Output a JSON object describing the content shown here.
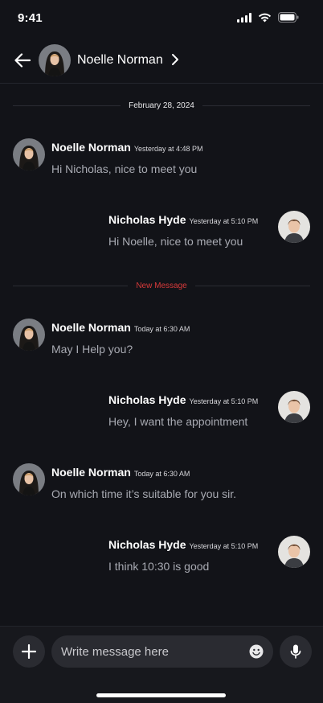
{
  "status_bar": {
    "time": "9:41"
  },
  "header": {
    "contact_name": "Noelle Norman"
  },
  "date_divider": "February 28, 2024",
  "new_divider": "New Message",
  "messages": [
    {
      "sender": "Noelle Norman",
      "time": "Yesterday at 4:48 PM",
      "text": "Hi Nicholas, nice to meet you",
      "direction": "incoming"
    },
    {
      "sender": "Nicholas Hyde",
      "time": "Yesterday at 5:10 PM",
      "text": "Hi Noelle, nice to meet you",
      "direction": "outgoing"
    },
    {
      "sender": "Noelle Norman",
      "time": "Today at 6:30 AM",
      "text": "May I Help you?",
      "direction": "incoming"
    },
    {
      "sender": "Nicholas Hyde",
      "time": "Yesterday at 5:10 PM",
      "text": "Hey, I want the appointment",
      "direction": "outgoing"
    },
    {
      "sender": "Noelle Norman",
      "time": "Today at 6:30 AM",
      "text": "On which time it’s suitable for you sir.",
      "direction": "incoming"
    },
    {
      "sender": "Nicholas Hyde",
      "time": "Yesterday at 5:10 PM",
      "text": "I think 10:30 is good",
      "direction": "outgoing"
    }
  ],
  "composer": {
    "placeholder": "Write message here"
  },
  "icons": {
    "back": "back-arrow-icon",
    "chevron": "chevron-right-icon",
    "add": "plus-icon",
    "emoji": "smiley-icon",
    "mic": "microphone-icon"
  },
  "colors": {
    "background": "#121318",
    "new_message_accent": "#d83a3a",
    "message_text": "#a8aab2",
    "bubble_surface": "#2a2b31"
  }
}
